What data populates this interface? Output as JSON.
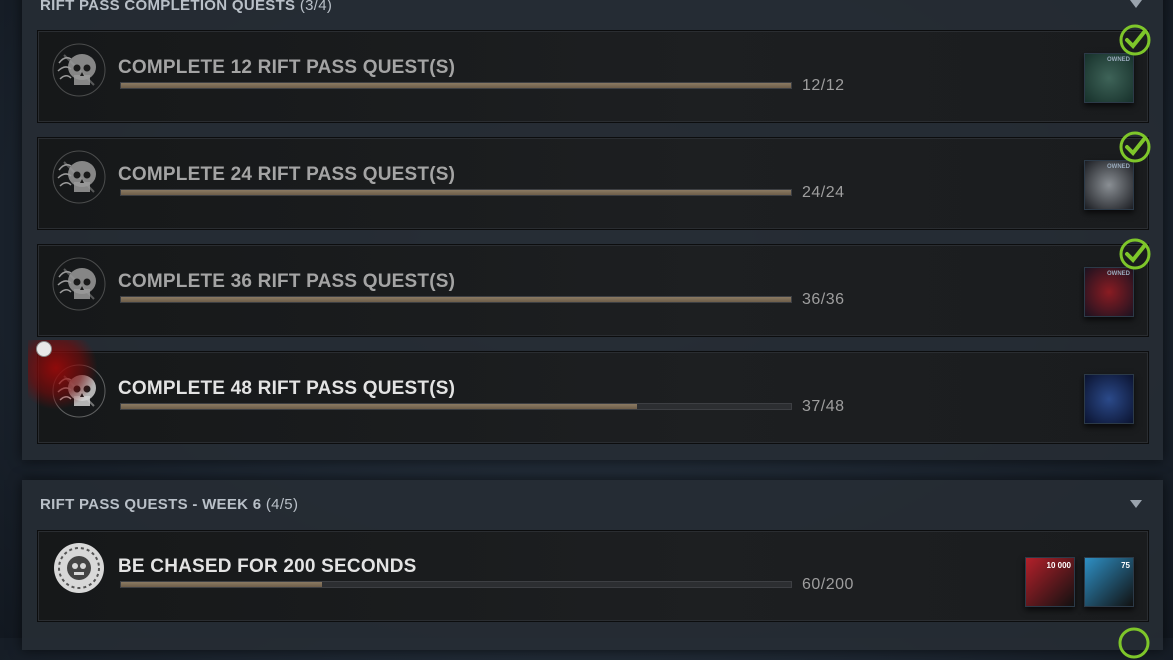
{
  "sections": [
    {
      "title": "RIFT PASS COMPLETION QUESTS",
      "count": "(3/4)",
      "quests": [
        {
          "title": "COMPLETE 12 RIFT PASS QUEST(S)",
          "progress_text": "12/12",
          "progress_fraction": 1.0,
          "completed": true,
          "reward_icon": "shirt-emblem-icon",
          "reward_tag": "OWNED"
        },
        {
          "title": "COMPLETE 24 RIFT PASS QUEST(S)",
          "progress_text": "24/24",
          "progress_fraction": 1.0,
          "completed": true,
          "reward_icon": "smoke-charm-icon",
          "reward_tag": "OWNED"
        },
        {
          "title": "COMPLETE 36 RIFT PASS QUEST(S)",
          "progress_text": "36/36",
          "progress_fraction": 1.0,
          "completed": true,
          "reward_icon": "red-creature-icon",
          "reward_tag": "OWNED"
        },
        {
          "title": "COMPLETE 48 RIFT PASS QUEST(S)",
          "progress_text": "37/48",
          "progress_fraction": 0.77,
          "completed": false,
          "reward_icon": "night-sky-icon",
          "reward_tag": ""
        }
      ]
    },
    {
      "title": "RIFT PASS QUESTS - WEEK 6",
      "count": "(4/5)",
      "quests": [
        {
          "title": "BE CHASED FOR 200 SECONDS",
          "progress_text": "60/200",
          "progress_fraction": 0.3,
          "completed": false,
          "rewards": [
            {
              "icon": "bloodpoints-icon",
              "amount": "10 000",
              "color": "#b3202a"
            },
            {
              "icon": "rift-fragment-icon",
              "amount": "75",
              "color": "#2e8fc4"
            }
          ]
        }
      ]
    }
  ],
  "colors": {
    "accent_check": "#7ec62a",
    "progress_fill": "#8b7a63",
    "blood": "#9a0c0c"
  }
}
